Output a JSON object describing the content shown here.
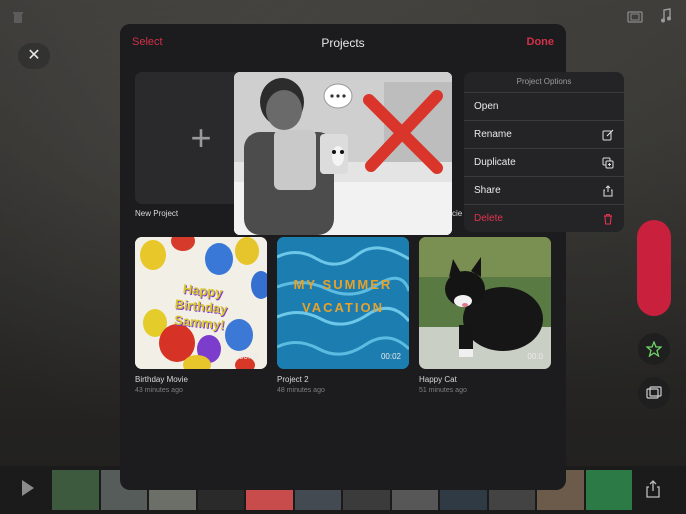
{
  "modal": {
    "select_label": "Select",
    "title": "Projects",
    "done_label": "Done"
  },
  "projects": [
    {
      "title": "New Project",
      "time": ""
    },
    {
      "title": "Birthday Movie",
      "time": "43 minutes ago",
      "duration": "00:05",
      "overlay_text": "Happy Birthday Sammy!"
    },
    {
      "title": "Project 2",
      "time": "48 minutes ago",
      "duration": "00:02",
      "overlay_text": "MY SUMMER VACATION"
    },
    {
      "title": "Happy Cat",
      "time": "51 minutes ago",
      "duration": "00:0"
    }
  ],
  "hidden_project_title_fragment": "cie",
  "menu": {
    "title": "Project Options",
    "items": [
      {
        "label": "Open",
        "icon": ""
      },
      {
        "label": "Rename",
        "icon": "edit-icon"
      },
      {
        "label": "Duplicate",
        "icon": "duplicate-icon"
      },
      {
        "label": "Share",
        "icon": "share-icon"
      },
      {
        "label": "Delete",
        "icon": "trash-icon"
      }
    ]
  },
  "colors": {
    "accent": "#d2304a",
    "record": "#c8203d",
    "modal_bg": "#1c1c1e"
  }
}
